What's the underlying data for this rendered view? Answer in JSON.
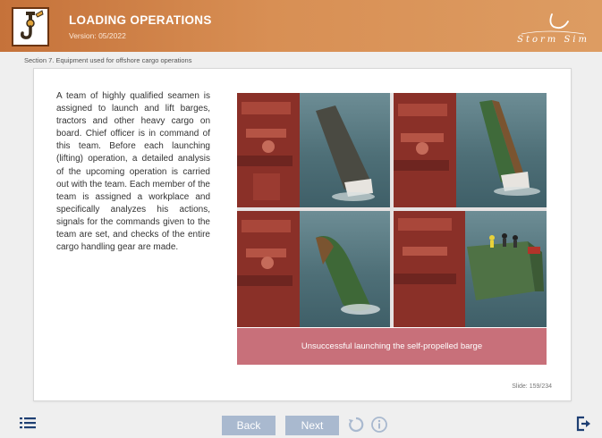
{
  "header": {
    "title": "LOADING OPERATIONS",
    "version": "Version: 05/2022",
    "brand": "Storm Sim"
  },
  "breadcrumb": "Section 7. Equipment used for offshore cargo operations",
  "content": {
    "paragraph": "A team of highly qualified seamen is assigned to launch and lift barges, tractors and other heavy cargo on board. Chief officer is in command of this team. Before each launching (lifting) operation, a detailed analysis of the upcoming operation is carried out with the team. Each member of the team is assigned a workplace and specifically analyzes his actions, signals for the commands given to the team are set, and checks of the entire cargo handling gear are made.",
    "caption": "Unsuccessful launching the self-propelled barge",
    "slide": "Slide: 159/234"
  },
  "footer": {
    "back_label": "Back",
    "next_label": "Next"
  },
  "icons": {
    "menu": "list-menu-icon",
    "replay": "replay-icon",
    "info": "info-icon",
    "exit": "exit-icon",
    "logo": "crane-hook-icon"
  },
  "colors": {
    "header_orange": "#d88f54",
    "caption_pink": "#c8707a",
    "button_blue": "#a9b9cf",
    "icon_navy": "#1e3f73"
  }
}
